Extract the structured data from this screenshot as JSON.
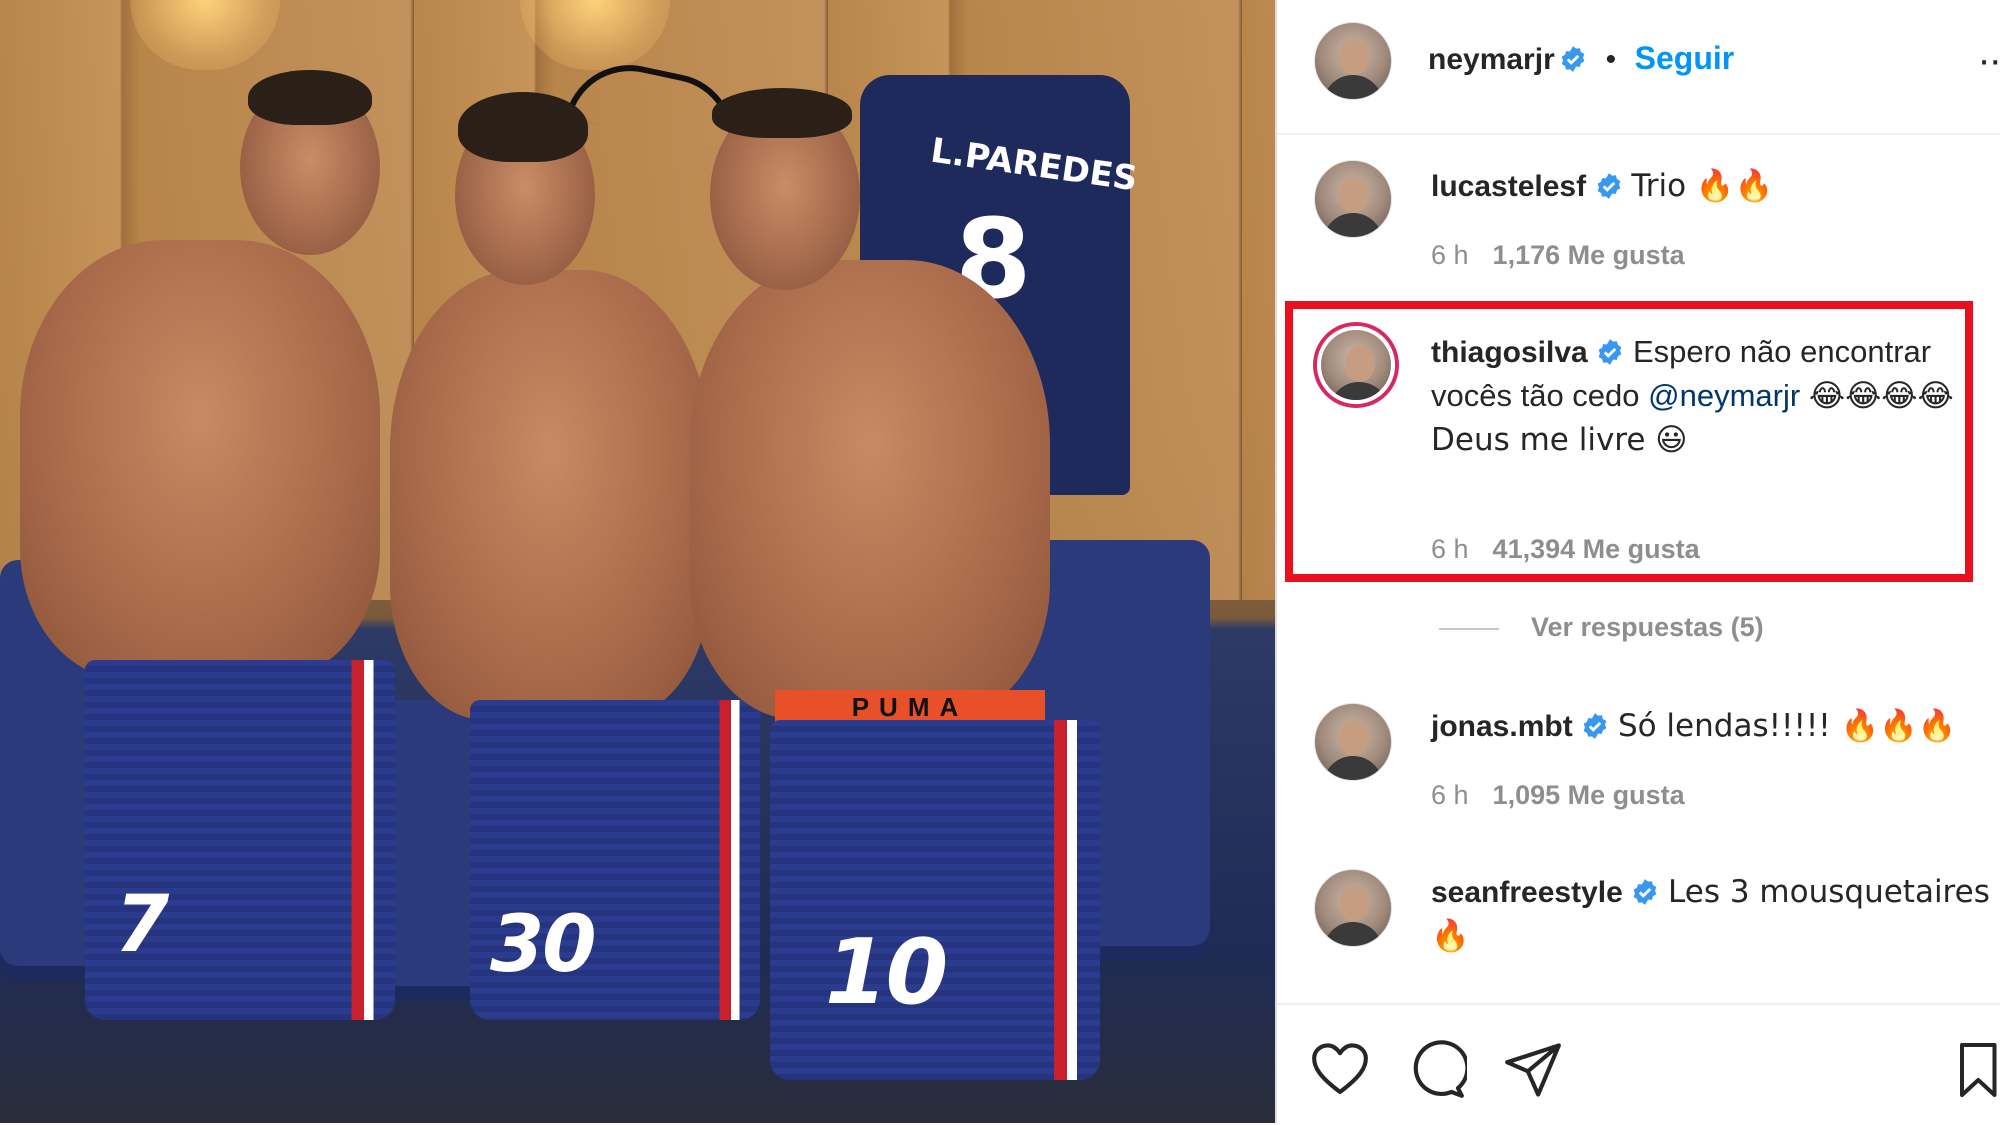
{
  "post_owner": {
    "username": "neymarjr",
    "follow_label": "Seguir",
    "separator": "•",
    "more": "··"
  },
  "photo": {
    "jersey_name": "L.PAREDES",
    "jersey_number": "8",
    "players": [
      {
        "number": "7"
      },
      {
        "number": "30"
      },
      {
        "number": "10"
      }
    ],
    "shorts_brand": "PUMA"
  },
  "comments": [
    {
      "username": "lucastelesf",
      "text": "Trio 🔥🔥",
      "time": "6 h",
      "likes": "1,176 Me gusta"
    },
    {
      "username": "thiagosilva",
      "text_before": "Espero não encontrar vocês tão cedo",
      "mention": "@neymarjr",
      "text_after": "😂😂😂😂 Deus me livre 😃",
      "time": "6 h",
      "likes": "41,394 Me gusta"
    },
    {
      "username": "jonas.mbt",
      "text": "Só lendas!!!!! 🔥🔥🔥",
      "time": "6 h",
      "likes": "1,095 Me gusta"
    },
    {
      "username": "seanfreestyle",
      "text": "Les 3 mousquetaires 🔥"
    }
  ],
  "replies_label": "Ver respuestas (5)",
  "colors": {
    "link_blue": "#0095f6",
    "verified_blue": "#3897f0",
    "highlight_red": "#e8101e",
    "text": "#262626",
    "muted": "#8e8e8e"
  },
  "icons": [
    "heart-icon",
    "comment-icon",
    "share-icon",
    "bookmark-icon",
    "verified-badge-icon"
  ]
}
